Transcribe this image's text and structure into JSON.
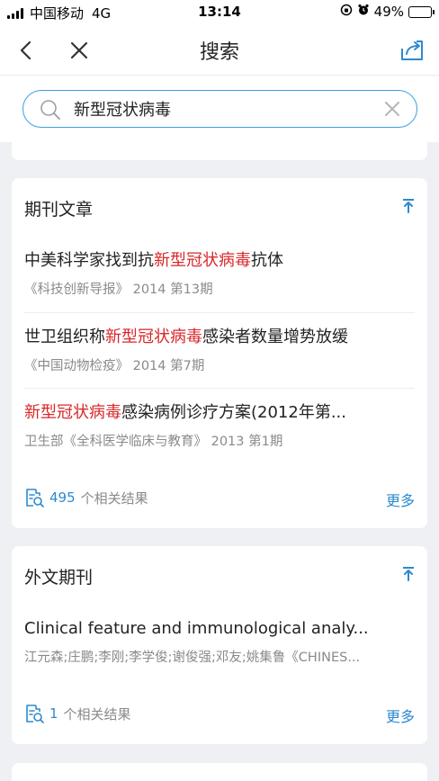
{
  "status_bar": {
    "carrier": "中国移动",
    "network": "4G",
    "time": "13:14",
    "battery": "49%",
    "battery_level": 0.49
  },
  "nav": {
    "title": "搜索"
  },
  "search": {
    "value": "新型冠状病毒",
    "placeholder": ""
  },
  "sections": [
    {
      "title": "期刊文章",
      "entries": [
        {
          "pre": "中美科学家找到抗",
          "hl": "新型冠状病毒",
          "post": "抗体",
          "meta": "《科技创新导报》 2014 第13期"
        },
        {
          "pre": "世卫组织称",
          "hl": "新型冠状病毒",
          "post": "感染者数量增势放缓",
          "meta": "《中国动物检疫》 2014 第7期"
        },
        {
          "pre": "",
          "hl": "新型冠状病毒",
          "post": "感染病例诊疗方案(2012年第...",
          "meta": "卫生部《全科医学临床与教育》 2013 第1期"
        }
      ],
      "count": "495",
      "count_suffix": "个相关结果",
      "more": "更多"
    },
    {
      "title": "外文期刊",
      "entries": [
        {
          "pre": "Clinical feature and immunological analy...",
          "hl": "",
          "post": "",
          "meta": "江元森;庄鹏;李刚;李学俊;谢俊强;邓友;姚集鲁《CHINES..."
        }
      ],
      "count": "1",
      "count_suffix": "个相关结果",
      "more": "更多"
    }
  ],
  "colors": {
    "accent": "#2c8ad0",
    "highlight": "#d9272a",
    "search_border": "#3ba1e0"
  }
}
